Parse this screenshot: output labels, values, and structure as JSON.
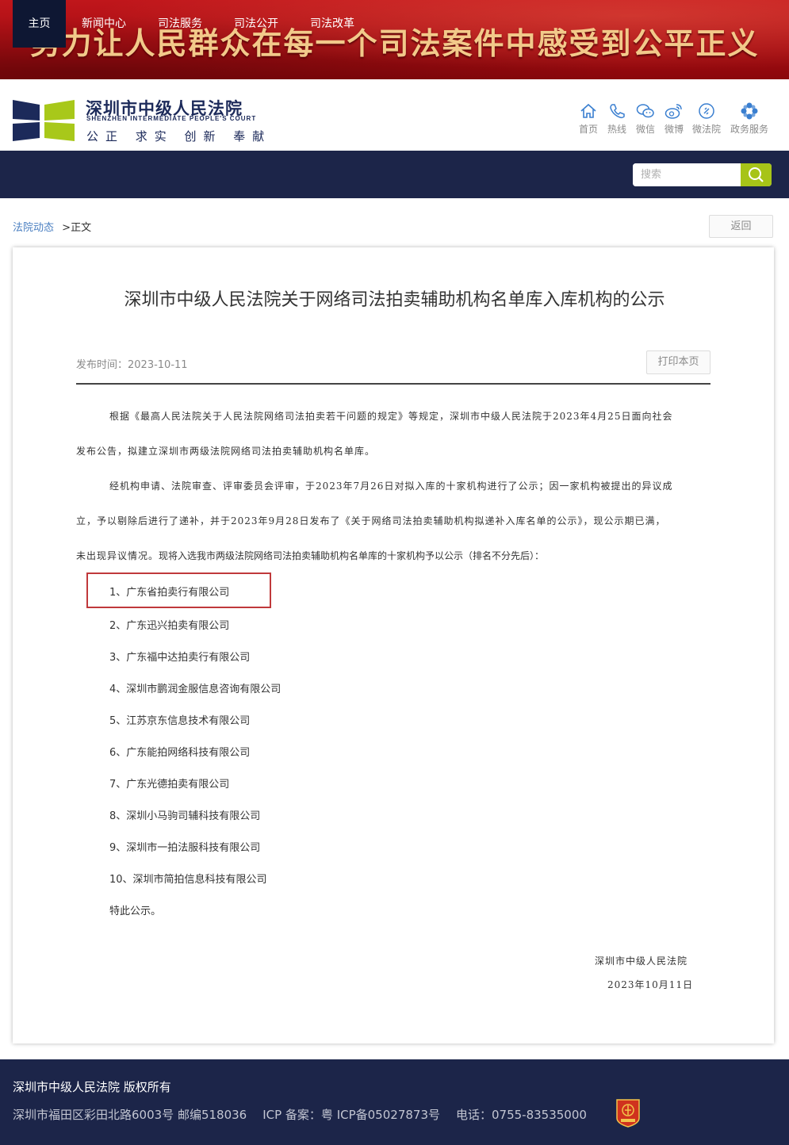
{
  "banner": {
    "slogan": "努力让人民群众在每一个司法案件中感受到公平正义"
  },
  "logo": {
    "cn_name": "深圳市中级人民法院",
    "en_name": "SHENZHEN INTERMEDIATE PEOPLE'S COURT",
    "motto": "公正 求实 创新 奉献"
  },
  "quick_links": [
    {
      "label": "首页",
      "icon": "home-icon"
    },
    {
      "label": "热线",
      "icon": "phone-icon"
    },
    {
      "label": "微信",
      "icon": "wechat-icon"
    },
    {
      "label": "微博",
      "icon": "weibo-icon"
    },
    {
      "label": "微法院",
      "icon": "micro-court-icon"
    },
    {
      "label": "政务服务",
      "icon": "gov-service-icon"
    }
  ],
  "nav": {
    "items": [
      "主页",
      "新闻中心",
      "司法服务",
      "司法公开",
      "司法改革"
    ],
    "active": "主页"
  },
  "search": {
    "placeholder": "搜索"
  },
  "breadcrumb": {
    "parent": "法院动态",
    "separator": ">",
    "current": "正文"
  },
  "back_label": "返回",
  "article": {
    "title": "深圳市中级人民法院关于网络司法拍卖辅助机构名单库入库机构的公示",
    "pub_date": "发布时间：2023-10-11",
    "print_label": "打印本页",
    "p1_line1": "根据《最高人民法院关于人民法院网络司法拍卖若干问题的规定》等规定，深圳市中级人民法院于2023年4月25日面向社会",
    "p1_line2": "发布公告，拟建立深圳市两级法院网络司法拍卖辅助机构名单库。",
    "p2_line1": "经机构申请、法院审查、评审委员会评审，于2023年7月26日对拟入库的十家机构进行了公示；因一家机构被提出的异议成",
    "p2_line2": "立，予以剔除后进行了递补，并于2023年9月28日发布了《关于网络司法拍卖辅助机构拟递补入库名单的公示》，现公示期已满，",
    "p2_line3a": "未出现异议情况。",
    "p2_line3b": "现将入选我市两级法院网络司法拍卖辅助机构名单库的十家机构予以公示（排名不分先后）：",
    "items": [
      "1、广东省拍卖行有限公司",
      "2、广东迅兴拍卖有限公司",
      "3、广东福中达拍卖行有限公司",
      "4、深圳市鹏润金服信息咨询有限公司",
      "5、江苏京东信息技术有限公司",
      "6、广东能拍网络科技有限公司",
      "7、广东光德拍卖有限公司",
      "8、深圳小马驹司辅科技有限公司",
      "9、深圳市一拍法服科技有限公司",
      "10、深圳市简拍信息科技有限公司"
    ],
    "closing": "特此公示。",
    "signature": "深圳市中级人民法院",
    "sign_date": "2023年10月11日"
  },
  "footer": {
    "copyright": "深圳市中级人民法院 版权所有",
    "address": "深圳市福田区彩田北路6003号 邮编518036",
    "icp": "ICP 备案：粤 ICP备05027873号",
    "phone": "电话：0755-83535000"
  },
  "colors": {
    "nav": "#1c2549",
    "banner": "#b0121a",
    "accent": "#a7c418",
    "highlight": "#c0393b"
  }
}
